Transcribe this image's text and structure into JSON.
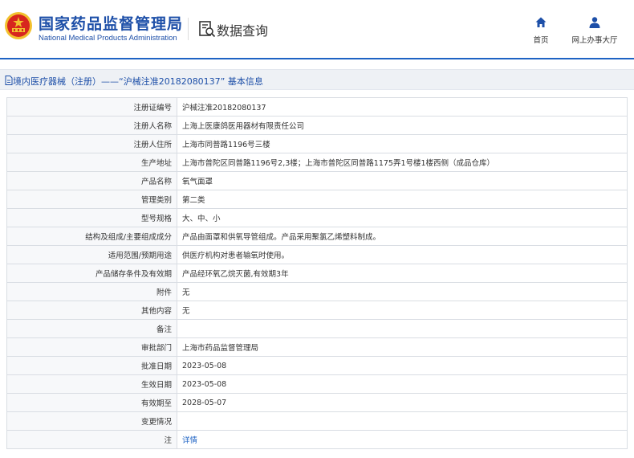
{
  "header": {
    "logo_cn": "国家药品监督管理局",
    "logo_en": "National Medical Products Administration",
    "query_title": "数据查询",
    "nav": {
      "home": "首页",
      "hall": "网上办事大厅"
    }
  },
  "breadcrumb": {
    "text": "境内医疗器械（注册）——“沪械注准20182080137” 基本信息"
  },
  "colors": {
    "brand_blue": "#1d4fa8",
    "accent_line": "#1e63c4",
    "emblem_red": "#d7261e",
    "emblem_gold": "#f2c12e"
  },
  "icons": {
    "home": "home-icon",
    "hall": "user-icon",
    "query": "search-document-icon",
    "crumb": "document-icon"
  },
  "rows": [
    {
      "label": "注册证编号",
      "value": "沪械注准20182080137"
    },
    {
      "label": "注册人名称",
      "value": "上海上医康鸽医用器材有限责任公司"
    },
    {
      "label": "注册人住所",
      "value": "上海市同普路1196号三楼"
    },
    {
      "label": "生产地址",
      "value": "上海市普陀区同普路1196号2,3楼；上海市普陀区同普路1175弄1号楼1楼西侧（成品仓库）"
    },
    {
      "label": "产品名称",
      "value": "氧气面罩"
    },
    {
      "label": "管理类别",
      "value": "第二类"
    },
    {
      "label": "型号规格",
      "value": "大、中、小"
    },
    {
      "label": "结构及组成/主要组成成分",
      "value": "产品由面罩和供氧导管组成。产品采用聚氯乙烯塑料制成。"
    },
    {
      "label": "适用范围/预期用途",
      "value": "供医疗机构对患者输氧时使用。"
    },
    {
      "label": "产品储存条件及有效期",
      "value": "产品经环氧乙烷灭菌,有效期3年"
    },
    {
      "label": "附件",
      "value": "无"
    },
    {
      "label": "其他内容",
      "value": "无"
    },
    {
      "label": "备注",
      "value": ""
    },
    {
      "label": "审批部门",
      "value": "上海市药品监督管理局"
    },
    {
      "label": "批准日期",
      "value": "2023-05-08"
    },
    {
      "label": "生效日期",
      "value": "2023-05-08"
    },
    {
      "label": "有效期至",
      "value": "2028-05-07"
    },
    {
      "label": "变更情况",
      "value": ""
    },
    {
      "label": "注",
      "value": "详情",
      "link": true
    }
  ]
}
